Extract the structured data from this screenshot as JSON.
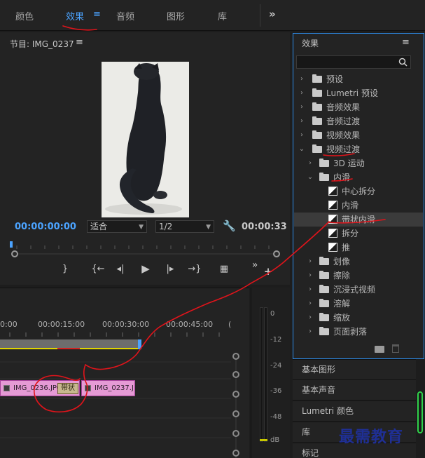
{
  "workspace_tabs": [
    "颜色",
    "效果",
    "音频",
    "图形",
    "库"
  ],
  "workspace_menu_glyph": "≡",
  "workspace_more_glyph": "»",
  "program": {
    "title": "节目: IMG_0237",
    "menu_glyph": "≡",
    "current_time": "00:00:00:00",
    "fit_value": "适合",
    "resolution_value": "1/2",
    "duration": "00:00:33",
    "controls": {
      "mark_out": "}",
      "go_to_in": "{←",
      "step_back": "◂|",
      "play": "▶",
      "step_forward": "|▸",
      "go_to_out": "→}",
      "export_frame": "▦",
      "more": "»",
      "add": "+"
    }
  },
  "timeline": {
    "time_labels": [
      "0:00",
      "00:00:15:00",
      "00:00:30:00",
      "00:00:45:00",
      "("
    ],
    "clips": [
      {
        "name": "IMG_0236.JPG"
      },
      {
        "name": "IMG_0237.J"
      }
    ],
    "transition_label": "带状"
  },
  "meters": {
    "db_labels": [
      "0",
      "-12",
      "-24",
      "-36",
      "-48",
      "dB"
    ]
  },
  "effects": {
    "title": "效果",
    "menu_glyph": "≡",
    "search_placeholder": "",
    "tree": [
      {
        "label": "预设",
        "icon": "preset-folder-icon",
        "expanded": false
      },
      {
        "label": "Lumetri 预设",
        "icon": "preset-folder-icon",
        "expanded": false
      },
      {
        "label": "音频效果",
        "icon": "folder-icon",
        "expanded": false
      },
      {
        "label": "音频过渡",
        "icon": "folder-icon",
        "expanded": false
      },
      {
        "label": "视频效果",
        "icon": "folder-icon",
        "expanded": false
      },
      {
        "label": "视频过渡",
        "icon": "folder-icon",
        "expanded": true
      },
      {
        "label": "3D 运动",
        "icon": "folder-icon",
        "expanded": false
      },
      {
        "label": "内滑",
        "icon": "folder-icon",
        "expanded": true
      },
      {
        "label": "中心拆分",
        "icon": "transition-icon"
      },
      {
        "label": "内滑",
        "icon": "transition-icon"
      },
      {
        "label": "带状内滑",
        "icon": "transition-icon",
        "selected": true
      },
      {
        "label": "拆分",
        "icon": "transition-icon"
      },
      {
        "label": "推",
        "icon": "transition-icon"
      },
      {
        "label": "划像",
        "icon": "folder-icon",
        "expanded": false
      },
      {
        "label": "擦除",
        "icon": "folder-icon",
        "expanded": false
      },
      {
        "label": "沉浸式视频",
        "icon": "folder-icon",
        "expanded": false
      },
      {
        "label": "溶解",
        "icon": "folder-icon",
        "expanded": false
      },
      {
        "label": "缩放",
        "icon": "folder-icon",
        "expanded": false
      },
      {
        "label": "页面剥落",
        "icon": "folder-icon",
        "expanded": false
      }
    ]
  },
  "side_panels": [
    "基本图形",
    "基本声音",
    "Lumetri 颜色",
    "库",
    "标记"
  ],
  "watermark": "最需教育",
  "colors": {
    "accent_blue": "#4ba3ff",
    "clip_pink": "#e59ad5",
    "annotation_red": "#e0141b",
    "watermark_blue": "#1f2f95"
  }
}
